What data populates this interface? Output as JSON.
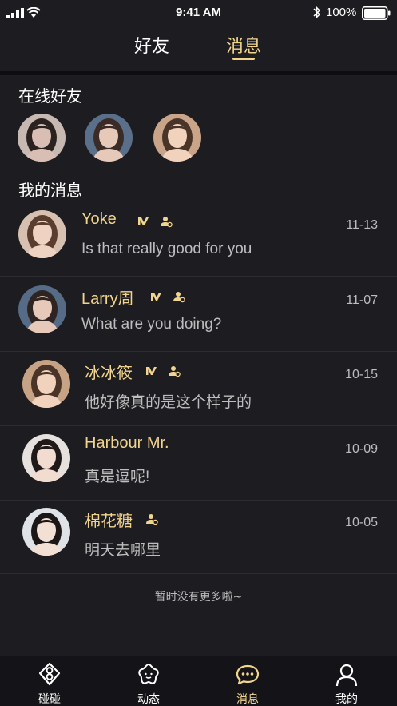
{
  "status_bar": {
    "time": "9:41 AM",
    "battery": "100%"
  },
  "top_tabs": {
    "friends": "好友",
    "messages": "消息",
    "active": "messages"
  },
  "online": {
    "title": "在线好友",
    "friends": [
      {
        "name": "online-friend-1",
        "skin": "#d9bfb3",
        "hair": "#2b2220",
        "bg": "#c7b8b2"
      },
      {
        "name": "online-friend-2",
        "skin": "#e6c9b8",
        "hair": "#3a2b26",
        "bg": "#5a6f8a"
      },
      {
        "name": "online-friend-3",
        "skin": "#f0d2bd",
        "hair": "#4a3428",
        "bg": "#c9a489"
      }
    ]
  },
  "messages": {
    "title": "我的消息",
    "items": [
      {
        "name": "Yoke",
        "text": "Is that really good for you",
        "date": "11-13",
        "vip": true,
        "verified": true
      },
      {
        "name": "Larry周",
        "text": "What are you doing?",
        "date": "11-07",
        "vip": true,
        "verified": true
      },
      {
        "name": "冰冰筱",
        "text": "他好像真的是这个样子的",
        "date": "10-15",
        "vip": true,
        "verified": true
      },
      {
        "name": "Harbour  Mr.",
        "text": "真是逗呢!",
        "date": "10-09",
        "vip": false,
        "verified": false
      },
      {
        "name": "棉花糖",
        "text": "明天去哪里",
        "date": "10-05",
        "vip": false,
        "verified": true
      }
    ]
  },
  "footer_note": "暂时没有更多啦~",
  "bottom_nav": [
    {
      "label": "碰碰",
      "icon": "match-icon",
      "active": false
    },
    {
      "label": "动态",
      "icon": "moments-icon",
      "active": false
    },
    {
      "label": "消息",
      "icon": "chat-bubble-icon",
      "active": true
    },
    {
      "label": "我的",
      "icon": "profile-icon",
      "active": false
    }
  ],
  "colors": {
    "accent": "#f2d58d",
    "background": "#1d1c21",
    "muted_text": "#bdbdbd"
  }
}
